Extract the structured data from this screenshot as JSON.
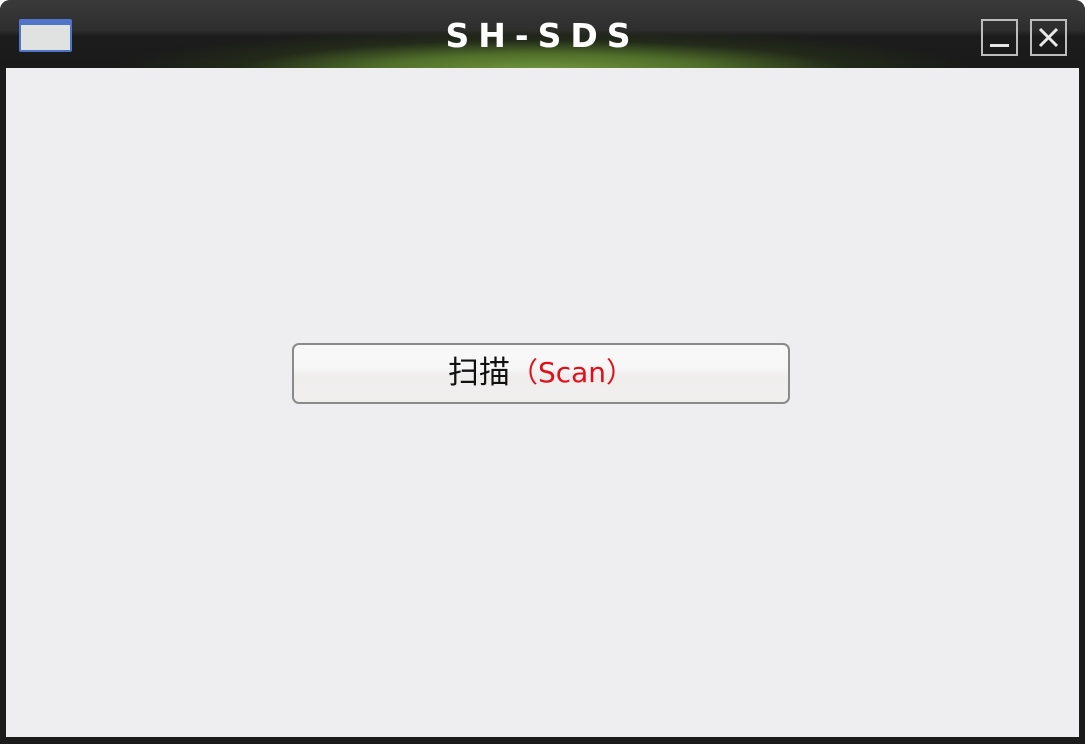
{
  "window": {
    "title": "SH-SDS",
    "minimize_icon": "minimize-icon",
    "close_icon": "close-icon",
    "app_icon": "window-app-icon"
  },
  "main": {
    "scan_label_cn": "扫描",
    "scan_label_en": "（Scan）"
  },
  "colors": {
    "titlebar": "#1b1b1b",
    "titlebar_glow": "#6a9a3a",
    "client_background": "#eeeef0",
    "scan_label_en": "#e0101a"
  }
}
